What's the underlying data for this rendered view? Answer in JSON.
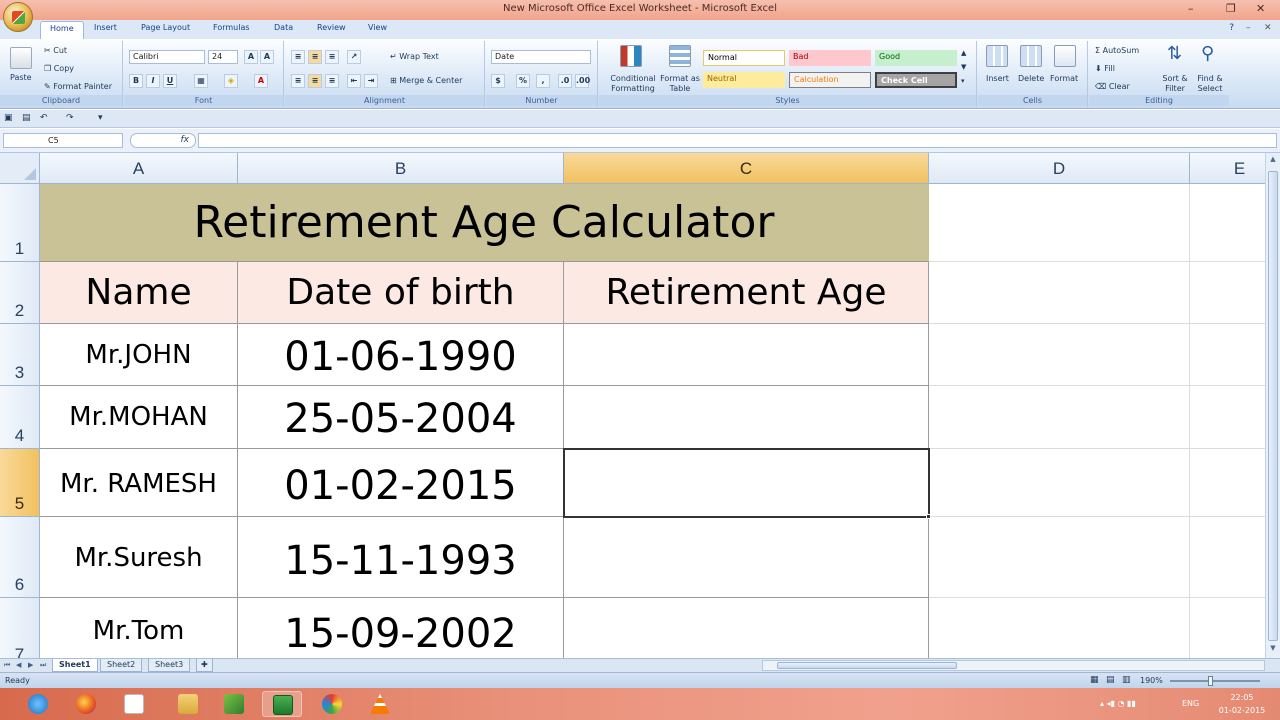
{
  "window": {
    "title": "New Microsoft Office Excel Worksheet - Microsoft Excel"
  },
  "tabs": [
    "Home",
    "Insert",
    "Page Layout",
    "Formulas",
    "Data",
    "Review",
    "View"
  ],
  "clipboard": {
    "paste": "Paste",
    "cut": "Cut",
    "copy": "Copy",
    "format_painter": "Format Painter",
    "label": "Clipboard"
  },
  "font": {
    "name": "Calibri",
    "size": "24",
    "bold": "B",
    "italic": "I",
    "underline": "U",
    "label": "Font"
  },
  "alignment": {
    "wrap_text": "Wrap Text",
    "merge_center": "Merge & Center",
    "label": "Alignment"
  },
  "number": {
    "format": "Date",
    "label": "Number"
  },
  "styles": {
    "conditional": "Conditional Formatting",
    "format_table": "Format as Table",
    "normal": "Normal",
    "bad": "Bad",
    "good": "Good",
    "neutral": "Neutral",
    "calculation": "Calculation",
    "check_cell": "Check Cell",
    "label": "Styles"
  },
  "cells_group": {
    "insert": "Insert",
    "delete": "Delete",
    "format": "Format",
    "label": "Cells"
  },
  "editing": {
    "autosum": "AutoSum",
    "fill": "Fill",
    "clear": "Clear",
    "sort_filter": "Sort & Filter",
    "find_select": "Find & Select",
    "label": "Editing"
  },
  "formula_bar": {
    "name_box": "C5",
    "fx": "fx",
    "content": ""
  },
  "columns": [
    "A",
    "B",
    "C",
    "D",
    "E"
  ],
  "rows": [
    "1",
    "2",
    "3",
    "4",
    "5",
    "6",
    "7"
  ],
  "sheet": {
    "title": "Retirement Age Calculator",
    "headers": [
      "Name",
      "Date of birth",
      "Retirement Age"
    ],
    "records": [
      {
        "name": "Mr.JOHN",
        "dob": "01-06-1990",
        "retirement": ""
      },
      {
        "name": "Mr.MOHAN",
        "dob": "25-05-2004",
        "retirement": ""
      },
      {
        "name": "Mr. RAMESH",
        "dob": "01-02-2015",
        "retirement": ""
      },
      {
        "name": "Mr.Suresh",
        "dob": "15-11-1993",
        "retirement": ""
      },
      {
        "name": "Mr.Tom",
        "dob": "15-09-2002",
        "retirement": ""
      }
    ]
  },
  "sheet_tabs": [
    "Sheet1",
    "Sheet2",
    "Sheet3"
  ],
  "status": {
    "text": "Ready",
    "zoom": "190%"
  },
  "taskbar": {
    "lang": "ENG",
    "time": "22:05",
    "date": "01-02-2015"
  },
  "colors": {
    "title_fill": "#c9c297",
    "header_fill": "#fce9e4",
    "selected_header": "#f1c15f"
  }
}
